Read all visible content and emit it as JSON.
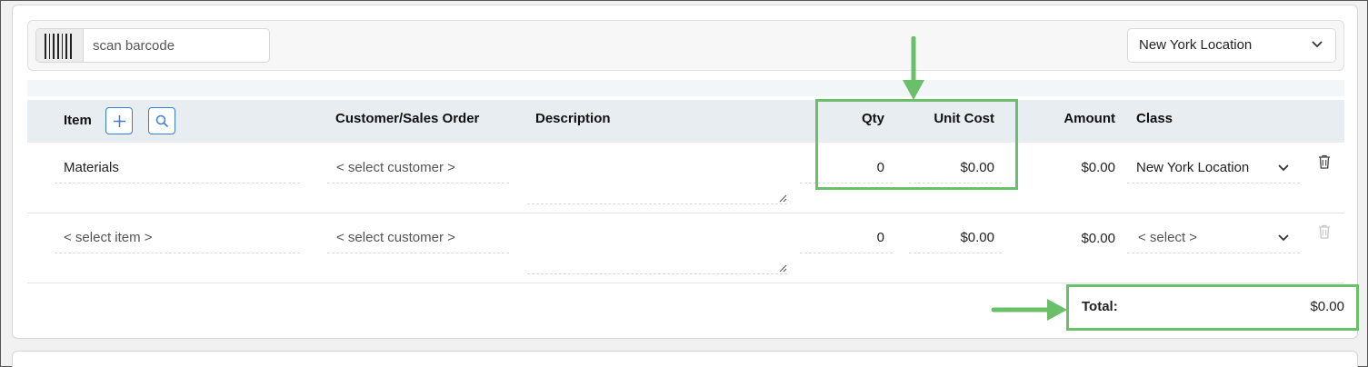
{
  "toolbar": {
    "barcode_placeholder": "scan barcode",
    "location_value": "New York Location",
    "icons": {
      "barcode": "barcode-icon",
      "chevron": "chevron-down-icon"
    }
  },
  "table": {
    "headers": {
      "item": "Item",
      "customer": "Customer/Sales Order",
      "description": "Description",
      "qty": "Qty",
      "unit_cost": "Unit Cost",
      "amount": "Amount",
      "class": "Class"
    },
    "header_icons": {
      "add": "plus-icon",
      "search": "search-icon"
    },
    "rows": [
      {
        "item": "Materials",
        "customer": "< select customer >",
        "description": "",
        "qty": "0",
        "unit_cost": "$0.00",
        "amount": "$0.00",
        "class": "New York Location"
      },
      {
        "item": "< select item >",
        "customer": "< select customer >",
        "description": "",
        "qty": "0",
        "unit_cost": "$0.00",
        "amount": "$0.00",
        "class": "< select >"
      }
    ]
  },
  "total": {
    "label": "Total:",
    "value": "$0.00"
  },
  "annotation_color": "#6abf69",
  "accent_color": "#3b7ddd"
}
